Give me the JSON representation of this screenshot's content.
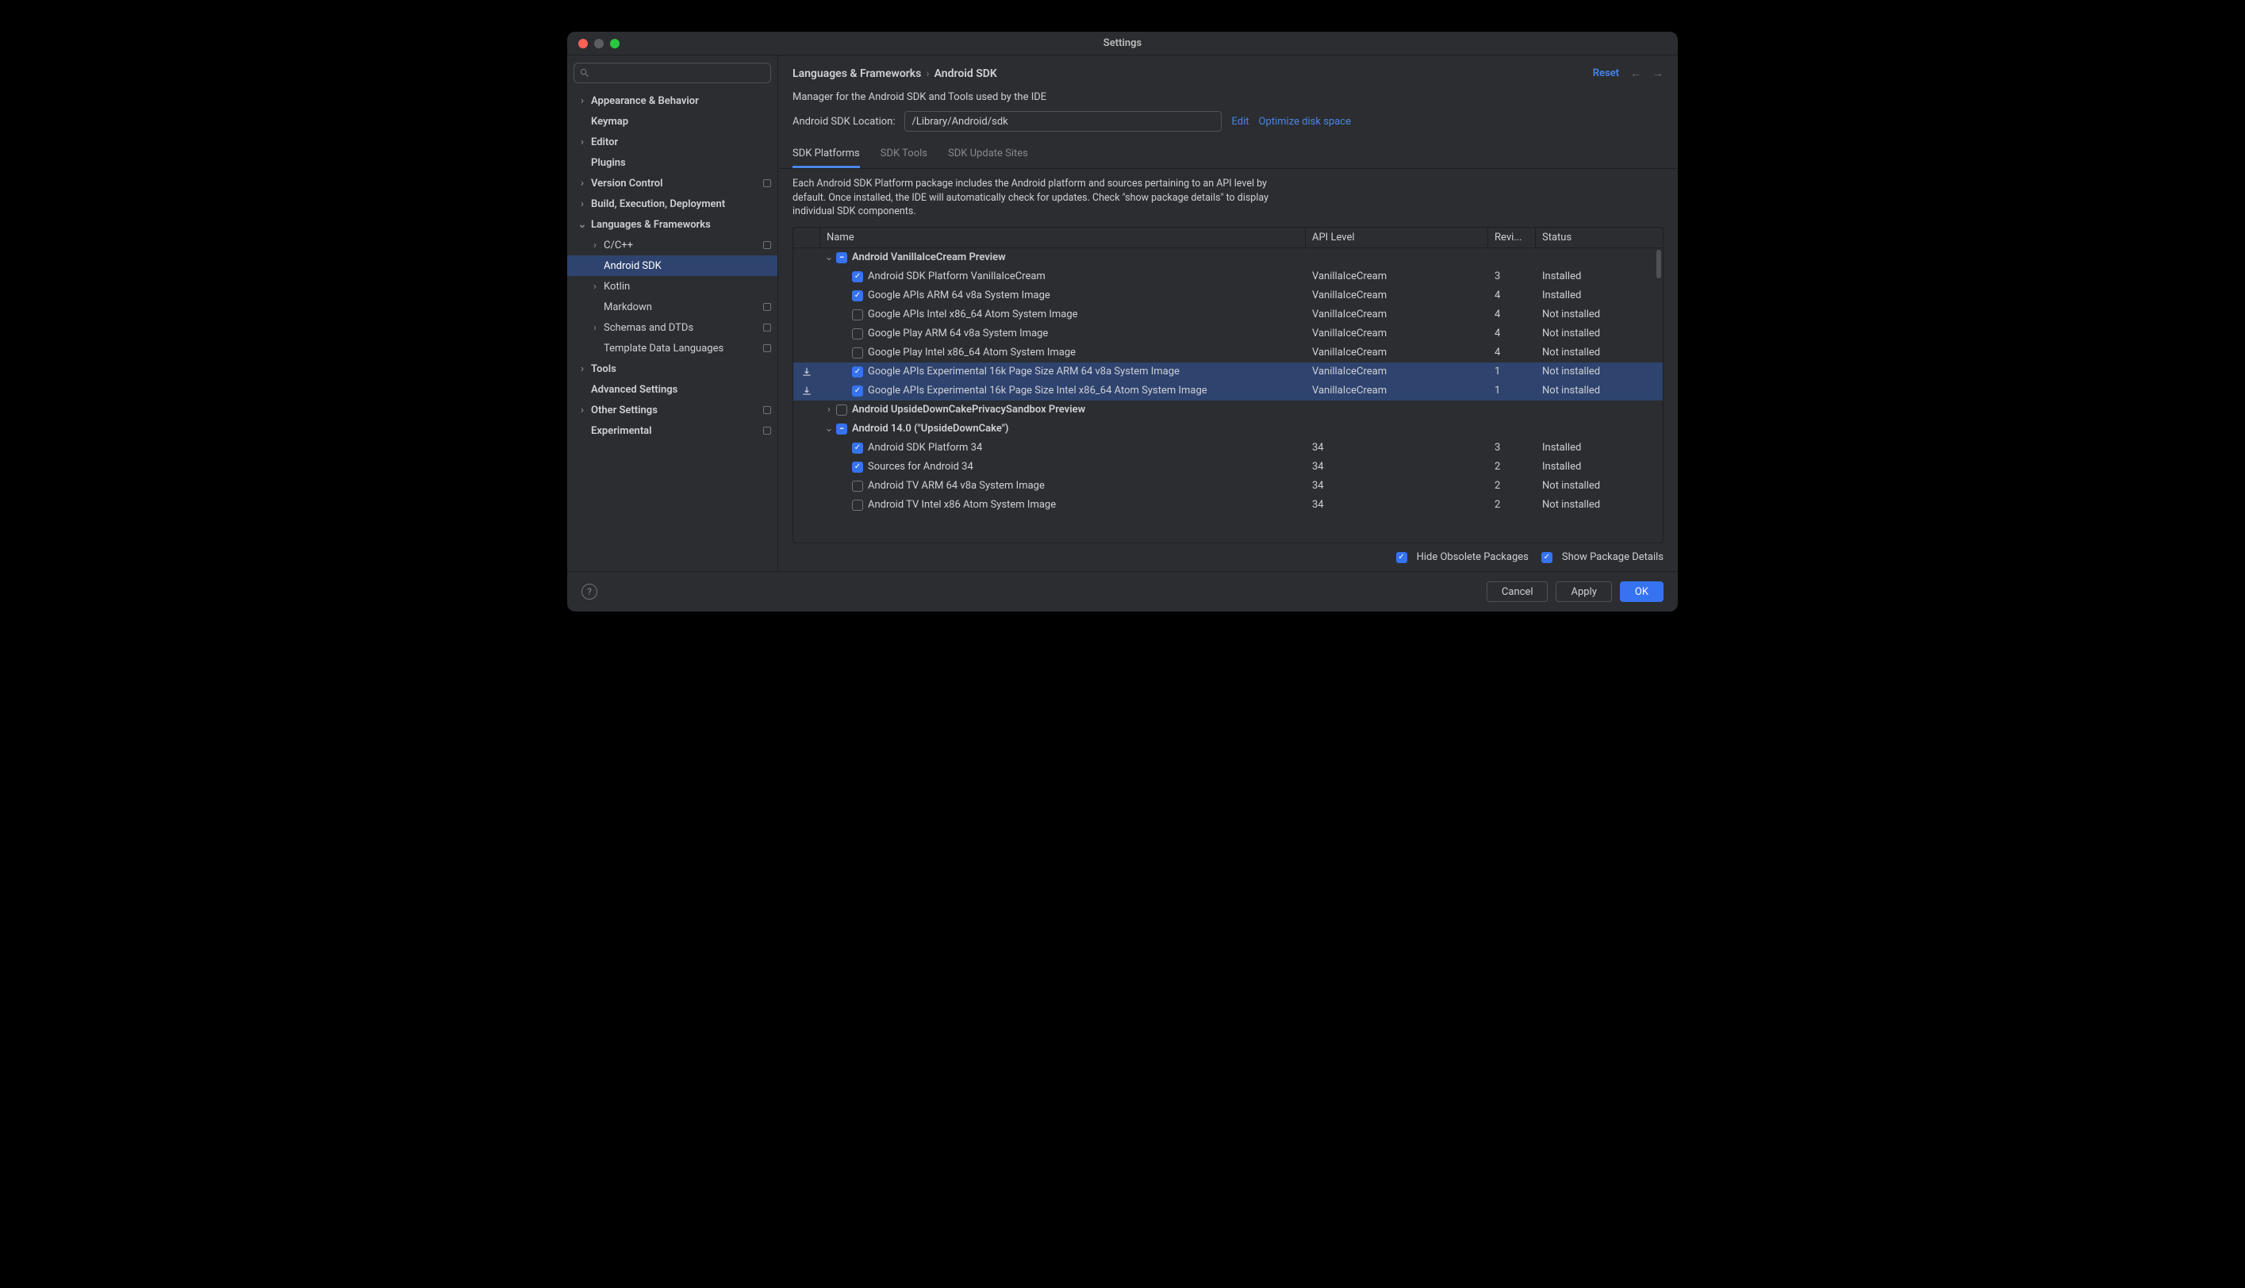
{
  "window": {
    "title": "Settings"
  },
  "header": {
    "crumb_a": "Languages & Frameworks",
    "crumb_b": "Android SDK",
    "reset": "Reset"
  },
  "sidebar": {
    "items": [
      {
        "label": "Appearance & Behavior",
        "depth": 0,
        "chev": "right",
        "bold": true
      },
      {
        "label": "Keymap",
        "depth": 0,
        "bold": true
      },
      {
        "label": "Editor",
        "depth": 0,
        "chev": "right",
        "bold": true
      },
      {
        "label": "Plugins",
        "depth": 0,
        "bold": true
      },
      {
        "label": "Version Control",
        "depth": 0,
        "chev": "right",
        "bold": true,
        "sq": true
      },
      {
        "label": "Build, Execution, Deployment",
        "depth": 0,
        "chev": "right",
        "bold": true
      },
      {
        "label": "Languages & Frameworks",
        "depth": 0,
        "chev": "down",
        "bold": true
      },
      {
        "label": "C/C++",
        "depth": 1,
        "chev": "right",
        "sq": true
      },
      {
        "label": "Android SDK",
        "depth": 1,
        "selected": true
      },
      {
        "label": "Kotlin",
        "depth": 1,
        "chev": "right"
      },
      {
        "label": "Markdown",
        "depth": 1,
        "sq": true
      },
      {
        "label": "Schemas and DTDs",
        "depth": 1,
        "chev": "right",
        "sq": true
      },
      {
        "label": "Template Data Languages",
        "depth": 1,
        "sq": true
      },
      {
        "label": "Tools",
        "depth": 0,
        "chev": "right",
        "bold": true
      },
      {
        "label": "Advanced Settings",
        "depth": 0,
        "bold": true
      },
      {
        "label": "Other Settings",
        "depth": 0,
        "chev": "right",
        "bold": true,
        "sq": true
      },
      {
        "label": "Experimental",
        "depth": 0,
        "bold": true,
        "sq": true
      }
    ]
  },
  "main": {
    "subtitle": "Manager for the Android SDK and Tools used by the IDE",
    "sdk_loc_label": "Android SDK Location:",
    "sdk_loc_value": "/Library/Android/sdk",
    "edit": "Edit",
    "optimize": "Optimize disk space",
    "tabs": [
      "SDK Platforms",
      "SDK Tools",
      "SDK Update Sites"
    ],
    "active_tab": 0,
    "desc": "Each Android SDK Platform package includes the Android platform and sources pertaining to an API level by default. Once installed, the IDE will automatically check for updates. Check \"show package details\" to display individual SDK components.",
    "columns": {
      "name": "Name",
      "api": "API Level",
      "rev": "Revi...",
      "status": "Status"
    },
    "rows": [
      {
        "type": "group",
        "expanded": true,
        "indeterminate": true,
        "name": "Android VanillaIceCream Preview"
      },
      {
        "type": "item",
        "checked": true,
        "name": "Android SDK Platform VanillaIceCream",
        "api": "VanillaIceCream",
        "rev": "3",
        "status": "Installed"
      },
      {
        "type": "item",
        "checked": true,
        "name": "Google APIs ARM 64 v8a System Image",
        "api": "VanillaIceCream",
        "rev": "4",
        "status": "Installed"
      },
      {
        "type": "item",
        "checked": false,
        "name": "Google APIs Intel x86_64 Atom System Image",
        "api": "VanillaIceCream",
        "rev": "4",
        "status": "Not installed"
      },
      {
        "type": "item",
        "checked": false,
        "name": "Google Play ARM 64 v8a System Image",
        "api": "VanillaIceCream",
        "rev": "4",
        "status": "Not installed"
      },
      {
        "type": "item",
        "checked": false,
        "name": "Google Play Intel x86_64 Atom System Image",
        "api": "VanillaIceCream",
        "rev": "4",
        "status": "Not installed"
      },
      {
        "type": "item",
        "checked": true,
        "name": "Google APIs Experimental 16k Page Size ARM 64 v8a System Image",
        "api": "VanillaIceCream",
        "rev": "1",
        "status": "Not installed",
        "sel": true,
        "dl": true
      },
      {
        "type": "item",
        "checked": true,
        "name": "Google APIs Experimental 16k Page Size Intel x86_64 Atom System Image",
        "api": "VanillaIceCream",
        "rev": "1",
        "status": "Not installed",
        "sel": true,
        "dl": true
      },
      {
        "type": "group",
        "expanded": false,
        "checked": false,
        "name": "Android UpsideDownCakePrivacySandbox Preview"
      },
      {
        "type": "group",
        "expanded": true,
        "indeterminate": true,
        "name": "Android 14.0 (\"UpsideDownCake\")"
      },
      {
        "type": "item",
        "checked": true,
        "name": "Android SDK Platform 34",
        "api": "34",
        "rev": "3",
        "status": "Installed"
      },
      {
        "type": "item",
        "checked": true,
        "name": "Sources for Android 34",
        "api": "34",
        "rev": "2",
        "status": "Installed"
      },
      {
        "type": "item",
        "checked": false,
        "name": "Android TV ARM 64 v8a System Image",
        "api": "34",
        "rev": "2",
        "status": "Not installed"
      },
      {
        "type": "item",
        "checked": false,
        "name": "Android TV Intel x86 Atom System Image",
        "api": "34",
        "rev": "2",
        "status": "Not installed"
      }
    ],
    "hide_obsolete": "Hide Obsolete Packages",
    "show_details": "Show Package Details"
  },
  "footer": {
    "cancel": "Cancel",
    "apply": "Apply",
    "ok": "OK"
  }
}
